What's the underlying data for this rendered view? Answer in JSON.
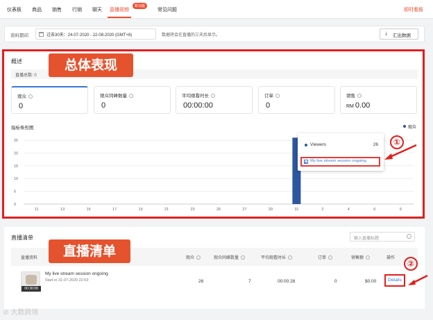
{
  "nav": {
    "tabs": [
      "仪表板",
      "商品",
      "销售",
      "行销",
      "聊天",
      "直播视频",
      "常见问题"
    ],
    "new_badge": "新功能",
    "realtime_link": "即时看板"
  },
  "date_bar": {
    "label": "资料期间",
    "range": "过去30天：24-07-2020 - 22-08-2020 (GMT+8)",
    "note": "数据将会在直播的三天后显示。",
    "export_label": "汇出数据"
  },
  "overview": {
    "title": "概述",
    "live_total": "直播总数: 0",
    "metrics": [
      {
        "label": "观众",
        "prefix": "",
        "value": "0"
      },
      {
        "label": "观众同峰数量",
        "prefix": "",
        "value": "0"
      },
      {
        "label": "平均观看时长",
        "prefix": "",
        "value": "00:00:00"
      },
      {
        "label": "订单",
        "prefix": "",
        "value": "0"
      },
      {
        "label": "销售",
        "prefix": "RM",
        "value": "0.00"
      }
    ],
    "chart_title": "指标条形图",
    "legend": "观众"
  },
  "chart_data": {
    "type": "bar",
    "categories": [
      "11",
      "13",
      "15",
      "17",
      "19",
      "21",
      "23",
      "25",
      "27",
      "29",
      "31",
      "2",
      "4",
      "6",
      "9"
    ],
    "series": [
      {
        "name": "观众",
        "values": [
          0,
          0,
          0,
          0,
          0,
          0,
          0,
          0,
          0,
          0,
          26,
          0,
          0,
          0,
          0
        ]
      }
    ],
    "y_ticks": [
      0,
      5,
      10,
      15,
      20,
      25
    ],
    "ylim": [
      0,
      25
    ],
    "bar_color": "#2c56a0",
    "tooltip": {
      "label": "Viewers",
      "value": "26",
      "session": "My live stream session ongoing"
    }
  },
  "annotations": {
    "overview_callout": "总体表现",
    "list_callout": "直播清单",
    "marker1": "①",
    "marker2": "②"
  },
  "live_list": {
    "title": "直播清单",
    "search_placeholder": "输入直播标题",
    "headers": [
      "直播资料",
      "观众",
      "观众同峰数量",
      "平均观看时长",
      "订单",
      "销售额",
      "操作"
    ],
    "rows": [
      {
        "title": "My live stream session ongoing",
        "start": "Start in 31-07-2020 22:53",
        "duration": "00:30:08",
        "viewers": "26",
        "peak": "7",
        "avg_watch": "00:00:28",
        "orders": "0",
        "sales": "$0.00",
        "action": "Details"
      }
    ]
  },
  "watermark": "大数跨境"
}
